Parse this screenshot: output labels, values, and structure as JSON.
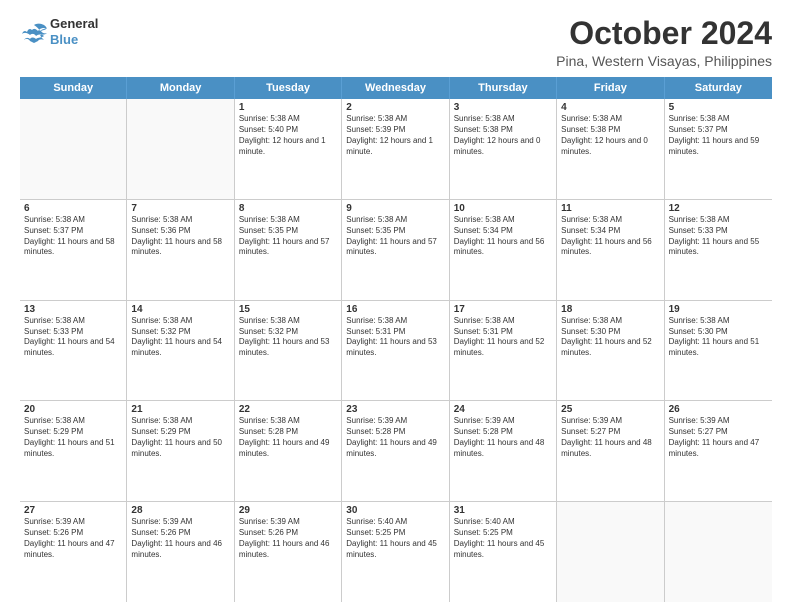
{
  "logo": {
    "line1": "General",
    "line2": "Blue"
  },
  "title": "October 2024",
  "location": "Pina, Western Visayas, Philippines",
  "header_days": [
    "Sunday",
    "Monday",
    "Tuesday",
    "Wednesday",
    "Thursday",
    "Friday",
    "Saturday"
  ],
  "weeks": [
    [
      {
        "day": "",
        "sunrise": "",
        "sunset": "",
        "daylight": "",
        "empty": true
      },
      {
        "day": "",
        "sunrise": "",
        "sunset": "",
        "daylight": "",
        "empty": true
      },
      {
        "day": "1",
        "sunrise": "Sunrise: 5:38 AM",
        "sunset": "Sunset: 5:40 PM",
        "daylight": "Daylight: 12 hours and 1 minute."
      },
      {
        "day": "2",
        "sunrise": "Sunrise: 5:38 AM",
        "sunset": "Sunset: 5:39 PM",
        "daylight": "Daylight: 12 hours and 1 minute."
      },
      {
        "day": "3",
        "sunrise": "Sunrise: 5:38 AM",
        "sunset": "Sunset: 5:38 PM",
        "daylight": "Daylight: 12 hours and 0 minutes."
      },
      {
        "day": "4",
        "sunrise": "Sunrise: 5:38 AM",
        "sunset": "Sunset: 5:38 PM",
        "daylight": "Daylight: 12 hours and 0 minutes."
      },
      {
        "day": "5",
        "sunrise": "Sunrise: 5:38 AM",
        "sunset": "Sunset: 5:37 PM",
        "daylight": "Daylight: 11 hours and 59 minutes."
      }
    ],
    [
      {
        "day": "6",
        "sunrise": "Sunrise: 5:38 AM",
        "sunset": "Sunset: 5:37 PM",
        "daylight": "Daylight: 11 hours and 58 minutes."
      },
      {
        "day": "7",
        "sunrise": "Sunrise: 5:38 AM",
        "sunset": "Sunset: 5:36 PM",
        "daylight": "Daylight: 11 hours and 58 minutes."
      },
      {
        "day": "8",
        "sunrise": "Sunrise: 5:38 AM",
        "sunset": "Sunset: 5:35 PM",
        "daylight": "Daylight: 11 hours and 57 minutes."
      },
      {
        "day": "9",
        "sunrise": "Sunrise: 5:38 AM",
        "sunset": "Sunset: 5:35 PM",
        "daylight": "Daylight: 11 hours and 57 minutes."
      },
      {
        "day": "10",
        "sunrise": "Sunrise: 5:38 AM",
        "sunset": "Sunset: 5:34 PM",
        "daylight": "Daylight: 11 hours and 56 minutes."
      },
      {
        "day": "11",
        "sunrise": "Sunrise: 5:38 AM",
        "sunset": "Sunset: 5:34 PM",
        "daylight": "Daylight: 11 hours and 56 minutes."
      },
      {
        "day": "12",
        "sunrise": "Sunrise: 5:38 AM",
        "sunset": "Sunset: 5:33 PM",
        "daylight": "Daylight: 11 hours and 55 minutes."
      }
    ],
    [
      {
        "day": "13",
        "sunrise": "Sunrise: 5:38 AM",
        "sunset": "Sunset: 5:33 PM",
        "daylight": "Daylight: 11 hours and 54 minutes."
      },
      {
        "day": "14",
        "sunrise": "Sunrise: 5:38 AM",
        "sunset": "Sunset: 5:32 PM",
        "daylight": "Daylight: 11 hours and 54 minutes."
      },
      {
        "day": "15",
        "sunrise": "Sunrise: 5:38 AM",
        "sunset": "Sunset: 5:32 PM",
        "daylight": "Daylight: 11 hours and 53 minutes."
      },
      {
        "day": "16",
        "sunrise": "Sunrise: 5:38 AM",
        "sunset": "Sunset: 5:31 PM",
        "daylight": "Daylight: 11 hours and 53 minutes."
      },
      {
        "day": "17",
        "sunrise": "Sunrise: 5:38 AM",
        "sunset": "Sunset: 5:31 PM",
        "daylight": "Daylight: 11 hours and 52 minutes."
      },
      {
        "day": "18",
        "sunrise": "Sunrise: 5:38 AM",
        "sunset": "Sunset: 5:30 PM",
        "daylight": "Daylight: 11 hours and 52 minutes."
      },
      {
        "day": "19",
        "sunrise": "Sunrise: 5:38 AM",
        "sunset": "Sunset: 5:30 PM",
        "daylight": "Daylight: 11 hours and 51 minutes."
      }
    ],
    [
      {
        "day": "20",
        "sunrise": "Sunrise: 5:38 AM",
        "sunset": "Sunset: 5:29 PM",
        "daylight": "Daylight: 11 hours and 51 minutes."
      },
      {
        "day": "21",
        "sunrise": "Sunrise: 5:38 AM",
        "sunset": "Sunset: 5:29 PM",
        "daylight": "Daylight: 11 hours and 50 minutes."
      },
      {
        "day": "22",
        "sunrise": "Sunrise: 5:38 AM",
        "sunset": "Sunset: 5:28 PM",
        "daylight": "Daylight: 11 hours and 49 minutes."
      },
      {
        "day": "23",
        "sunrise": "Sunrise: 5:39 AM",
        "sunset": "Sunset: 5:28 PM",
        "daylight": "Daylight: 11 hours and 49 minutes."
      },
      {
        "day": "24",
        "sunrise": "Sunrise: 5:39 AM",
        "sunset": "Sunset: 5:28 PM",
        "daylight": "Daylight: 11 hours and 48 minutes."
      },
      {
        "day": "25",
        "sunrise": "Sunrise: 5:39 AM",
        "sunset": "Sunset: 5:27 PM",
        "daylight": "Daylight: 11 hours and 48 minutes."
      },
      {
        "day": "26",
        "sunrise": "Sunrise: 5:39 AM",
        "sunset": "Sunset: 5:27 PM",
        "daylight": "Daylight: 11 hours and 47 minutes."
      }
    ],
    [
      {
        "day": "27",
        "sunrise": "Sunrise: 5:39 AM",
        "sunset": "Sunset: 5:26 PM",
        "daylight": "Daylight: 11 hours and 47 minutes."
      },
      {
        "day": "28",
        "sunrise": "Sunrise: 5:39 AM",
        "sunset": "Sunset: 5:26 PM",
        "daylight": "Daylight: 11 hours and 46 minutes."
      },
      {
        "day": "29",
        "sunrise": "Sunrise: 5:39 AM",
        "sunset": "Sunset: 5:26 PM",
        "daylight": "Daylight: 11 hours and 46 minutes."
      },
      {
        "day": "30",
        "sunrise": "Sunrise: 5:40 AM",
        "sunset": "Sunset: 5:25 PM",
        "daylight": "Daylight: 11 hours and 45 minutes."
      },
      {
        "day": "31",
        "sunrise": "Sunrise: 5:40 AM",
        "sunset": "Sunset: 5:25 PM",
        "daylight": "Daylight: 11 hours and 45 minutes."
      },
      {
        "day": "",
        "sunrise": "",
        "sunset": "",
        "daylight": "",
        "empty": true
      },
      {
        "day": "",
        "sunrise": "",
        "sunset": "",
        "daylight": "",
        "empty": true
      }
    ]
  ]
}
